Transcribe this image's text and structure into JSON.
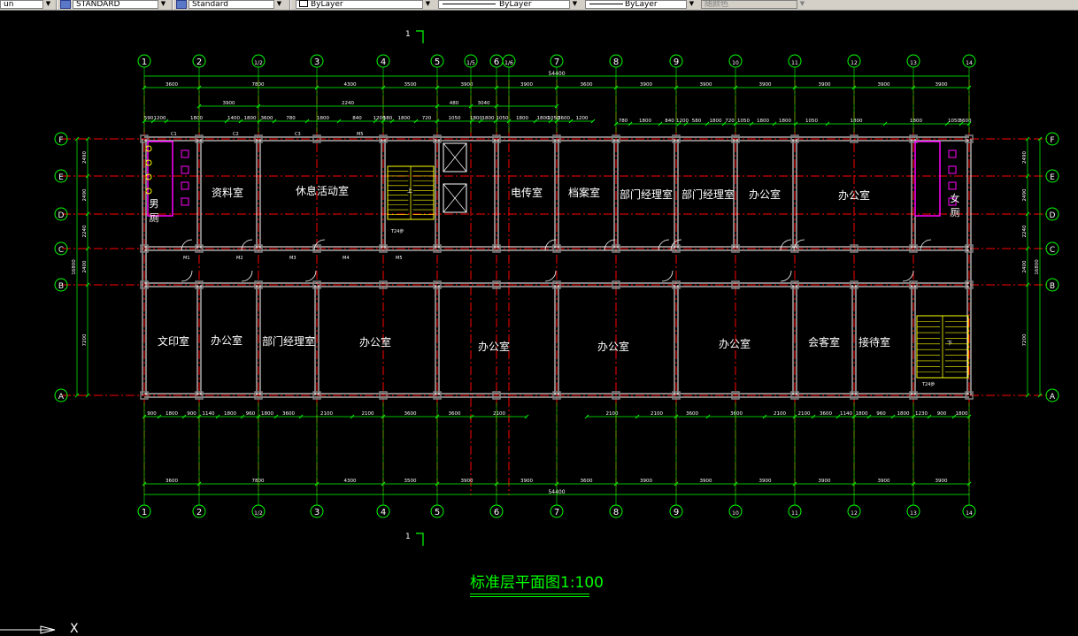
{
  "toolbar": {
    "left_fragment": "un",
    "text_style": "STANDARD",
    "dim_style": "Standard",
    "color": "ByLayer",
    "linetype": "ByLayer",
    "lineweight": "ByLayer",
    "plot_style": "随颜色"
  },
  "section_marker": "1",
  "grid_axes_top": [
    "1",
    "2",
    "1/2",
    "3",
    "4",
    "5",
    "1/5",
    "6",
    "1/6",
    "7",
    "8",
    "9",
    "10",
    "11",
    "12",
    "13",
    "14"
  ],
  "grid_axes_bottom": [
    "1",
    "2",
    "1/2",
    "3",
    "4",
    "5",
    "6",
    "7",
    "8",
    "9",
    "10",
    "11",
    "12",
    "13",
    "14"
  ],
  "grid_axes_rows": [
    "F",
    "E",
    "D",
    "C",
    "B",
    "A"
  ],
  "overall_width": "54400",
  "bay_dims_top": [
    "3600",
    "7800",
    "4300",
    "3500",
    "3900",
    "3900",
    "3600",
    "3900",
    "3900",
    "3900",
    "3900",
    "3900",
    "3900",
    "3600"
  ],
  "bay_dims_bottom": [
    "3600",
    "7800",
    "4300",
    "3500",
    "3900",
    "3900",
    "3600",
    "3900",
    "3900",
    "3900",
    "3900",
    "3900",
    "3900",
    "3600"
  ],
  "secondary_dims_top": [
    "3900",
    "2240",
    "480",
    "3040"
  ],
  "window_dims_top": [
    "590",
    "1200",
    "1800",
    "1400",
    "1800",
    "3600",
    "780",
    "1800",
    "840",
    "1200",
    "580",
    "1800",
    "720",
    "1050",
    "1800",
    "1800",
    "1050",
    "1800",
    "1800",
    "1050",
    "3600",
    "1200",
    "590"
  ],
  "window_dims_bottom": [
    "900",
    "1800",
    "900",
    "1140",
    "1800",
    "960",
    "1800",
    "3600",
    "2100",
    "2100",
    "3600",
    "3600",
    "2100",
    "2100",
    "3600",
    "1140",
    "1800",
    "960",
    "1800",
    "1230",
    "900",
    "1800",
    "900"
  ],
  "side_dims_left": [
    "2490",
    "2490",
    "2240",
    "2400",
    "7200",
    "16800"
  ],
  "side_dims_right": [
    "2490",
    "2490",
    "2240",
    "2400",
    "7200",
    "16800"
  ],
  "rooms": {
    "mens_toilet": "男厕",
    "archive_room": "资料室",
    "lounge": "休息活动室",
    "telecom_room": "电传室",
    "records_room": "档案室",
    "dept_manager_1": "部门经理室",
    "dept_manager_2": "部门经理室",
    "office_n1": "办公室",
    "office_n2": "办公室",
    "womens_toilet": "女厕",
    "print_room": "文印室",
    "office_s1": "办公室",
    "dept_manager_s": "部门经理室",
    "office_s2": "办公室",
    "office_s3": "办公室",
    "office_s4": "办公室",
    "office_s5": "办公室",
    "guest_room": "会客室",
    "reception_room": "接待室"
  },
  "door_tags": [
    "M1",
    "M2",
    "M3",
    "M4",
    "M5"
  ],
  "window_tags": [
    "C1",
    "C2",
    "C3",
    "M5"
  ],
  "stair_labels": [
    "T24步",
    "T24步",
    "上",
    "下"
  ],
  "plan_title": "标准层平面图1:100",
  "ucs_axis": "X",
  "colors": {
    "background": "#000000",
    "walls": "#ffffff",
    "axis_lines": "#ff0000",
    "dimensions": "#00ff00",
    "stairs": "#ffff00",
    "fixtures": "#ff00ff",
    "columns": "#808080"
  }
}
